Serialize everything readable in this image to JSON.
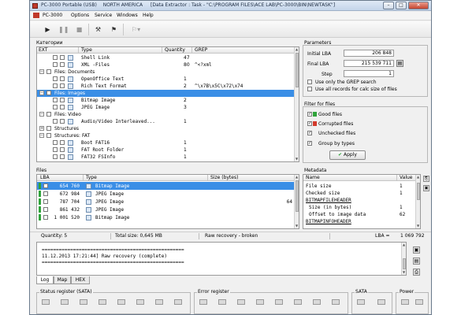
{
  "window": {
    "app_title": "PC-3000 Portable (USB)",
    "region": "NORTH AMERICA",
    "task_text": "[Data Extractor : Task - \"C:\\PROGRAM FILES\\ACE LAB\\PC-3000\\BIN\\NEWTASK\"]"
  },
  "menu": {
    "logo_text": "PC-3000",
    "items": [
      "Options",
      "Service",
      "Windows",
      "Help"
    ]
  },
  "categories": {
    "group_label": "Категории",
    "columns": [
      "EXT",
      "Type",
      "Quantity",
      "GREP"
    ],
    "rows": [
      {
        "type": "Shell Link",
        "quantity": "47",
        "grep": ""
      },
      {
        "type": "XML -Files",
        "quantity": "80",
        "grep": "^<?xml"
      },
      {
        "type": "Files: Documents",
        "quantity": "",
        "grep": ""
      },
      {
        "type": "OpenOffice Text",
        "quantity": "1",
        "grep": ""
      },
      {
        "type": "Rich Text Format",
        "quantity": "2",
        "grep": "^\\x7B\\x5C\\x72\\x74"
      },
      {
        "type": "Files: Images",
        "quantity": "",
        "grep": ""
      },
      {
        "type": "Bitmap Image",
        "quantity": "2",
        "grep": ""
      },
      {
        "type": "JPEG Image",
        "quantity": "3",
        "grep": ""
      },
      {
        "type": "Files: Video",
        "quantity": "",
        "grep": ""
      },
      {
        "type": "Audio/Video Interleaved...",
        "quantity": "1",
        "grep": ""
      },
      {
        "type": "Structures",
        "quantity": "",
        "grep": ""
      },
      {
        "type": "Structures: FAT",
        "quantity": "",
        "grep": ""
      },
      {
        "type": "Boot FAT16",
        "quantity": "1",
        "grep": ""
      },
      {
        "type": "FAT Root Folder",
        "quantity": "1",
        "grep": ""
      },
      {
        "type": "FAT32 FSInfo",
        "quantity": "1",
        "grep": ""
      }
    ]
  },
  "parameters": {
    "group_label": "Parameters",
    "initial_lba_label": "Initial LBA",
    "initial_lba": "206 848",
    "final_lba_label": "Final LBA",
    "final_lba": "215 539 711",
    "step_label": "Step",
    "step": "1",
    "grep_only_label": "Use only the GREP search",
    "calc_size_label": "Use all records for calc size of files"
  },
  "filter": {
    "group_label": "Filter for files",
    "good_label": "Good files",
    "corrupted_label": "Corrupted files",
    "unchecked_label": "Unchecked files",
    "group_types_label": "Group by types",
    "apply_label": "Apply"
  },
  "files": {
    "group_label": "Files",
    "columns": [
      "LBA",
      "Type",
      "Size (bytes)"
    ],
    "rows": [
      {
        "lba": "654 760",
        "type": "Bitmap Image",
        "size": ""
      },
      {
        "lba": "672 984",
        "type": "JPEG Image",
        "size": ""
      },
      {
        "lba": "787 704",
        "type": "JPEG Image",
        "size": "64"
      },
      {
        "lba": "861 432",
        "type": "JPEG Image",
        "size": ""
      },
      {
        "lba": "1 001 520",
        "type": "Bitmap Image",
        "size": ""
      }
    ]
  },
  "metadata": {
    "group_label": "Metadata",
    "columns": [
      "Name",
      "Value"
    ],
    "rows": [
      {
        "name": "File size",
        "value": "1"
      },
      {
        "name": "Checked size",
        "value": "1"
      },
      {
        "name": "BITMAPFILEHEADER",
        "value": ""
      },
      {
        "name": "Size (in bytes)",
        "value": "1"
      },
      {
        "name": "Offset to image data",
        "value": "62"
      },
      {
        "name": "BITMAPINFOHEADER",
        "value": ""
      }
    ]
  },
  "status": {
    "quantity": "Quantity: 5",
    "total_size": "Total size: 0,645 MB",
    "raw_recovery": "Raw recovery - broken",
    "lba": "LBA =",
    "lba_value": "1 069 792"
  },
  "log": {
    "separator": "==================================================",
    "line": "11.12.2013 17:21:44] Raw recovery (complete)",
    "tabs": [
      "Log",
      "Map",
      "HEX"
    ]
  },
  "registers": {
    "status_label": "Status register (SATA)",
    "error_label": "Error register",
    "sata_label": "SATA",
    "power_label": "Power"
  }
}
